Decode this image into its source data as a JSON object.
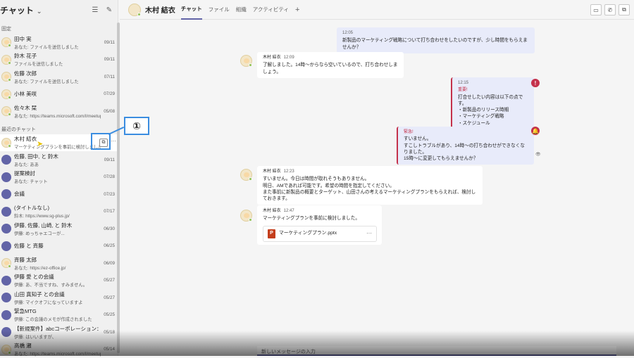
{
  "sidebar": {
    "title": "チャット",
    "pinned_label": "固定",
    "recent_label": "最近のチャット",
    "pinned": [
      {
        "name": "田中 実",
        "preview": "あなた: ファイルを送信しました",
        "date": "09/11"
      },
      {
        "name": "鈴木 花子",
        "preview": "ファイルを送信しました",
        "date": "09/11"
      },
      {
        "name": "佐藤 次郎",
        "preview": "あなた: ファイルを送信しました",
        "date": "07/11"
      },
      {
        "name": "小林 美咲",
        "preview": "",
        "date": "07/29"
      },
      {
        "name": "佐々木 栞",
        "preview": "あなた: https://teams.microsoft.com/l/meetup-joi...",
        "date": "05/08"
      }
    ],
    "recent": [
      {
        "name": "木村 結衣",
        "preview": "マーケティングプランを事前に検討しました。",
        "date": ""
      },
      {
        "name": "佐藤, 田中, と 鈴木",
        "preview": "あなた: ああ",
        "date": "09/11"
      },
      {
        "name": "提案検討",
        "preview": "あなた: チャット",
        "date": "07/28"
      },
      {
        "name": "会議",
        "preview": "",
        "date": "07/23"
      },
      {
        "name": "(タイトルなし)",
        "preview": "鈴木: https://www.sg-plus.jp/",
        "date": "07/17"
      },
      {
        "name": "伊藤, 佐藤, 山崎, と 鈴木",
        "preview": "伊藤: めっちゃエコーが...",
        "date": "06/30"
      },
      {
        "name": "佐藤 と 斉藤",
        "preview": "",
        "date": "06/25"
      },
      {
        "name": "斉藤 太郎",
        "preview": "あなた: https://ez-office.jp/",
        "date": "06/09"
      },
      {
        "name": "伊藤 愛 との会議",
        "preview": "伊藤: あ、不当ですね、すみません。",
        "date": "05/27"
      },
      {
        "name": "山田 真知子 との会議",
        "preview": "伊藤: マイクオフになっていますよ",
        "date": "05/27"
      },
      {
        "name": "緊急MTG",
        "preview": "伊藤: この会議のメモが作成されました",
        "date": "05/25"
      },
      {
        "name": "【新規案件】abcコーポレーション：ヒアリン...",
        "preview": "伊藤: はいいますが、",
        "date": "05/18"
      },
      {
        "name": "高橋 瀬",
        "preview": "あなた: https://teams.microsoft.com/l/meetup-joi...",
        "date": "05/14"
      }
    ]
  },
  "header": {
    "contact_name": "木村 結衣",
    "tabs": [
      "チャット",
      "ファイル",
      "組織",
      "アクティビティ"
    ]
  },
  "callout": {
    "label": "①"
  },
  "messages": {
    "m1": {
      "time": "12:05",
      "text": "新製品のマーケティング戦略について打ち合わせをしたいのですが、少し時間をもらえませんか？"
    },
    "m2": {
      "sender": "木村 結衣",
      "time": "12:09",
      "text": "了解しました。14時〜からなら空いているので、打ち合わせしましょう。"
    },
    "m3": {
      "time": "12:15",
      "flag": "重要!",
      "lines": [
        "打合せしたい内容は以下の点です。",
        "・新製品のリリース時期",
        "・マーケティング戦略",
        "・スケジュール"
      ]
    },
    "m4": {
      "flag": "緊急!",
      "lines": [
        "すいません。",
        "すこしトラブルがあり、14時〜の打ち合わせができなくなりました。",
        "15時〜に変更してもらえませんか？"
      ]
    },
    "m5": {
      "sender": "木村 結衣",
      "time": "12:23",
      "lines": [
        "すいません。今日は時間が取れそうもありません。",
        "明日、AMであれば可能です。希望の時間を指定してください。",
        "また事前に新製品の概要とターゲット、山田さんの考えるマーケティングプランをもらえれば、検討しておきます。"
      ]
    },
    "m6": {
      "sender": "木村 結衣",
      "time": "12:47",
      "text": "マーケティングプランを事前に検討しました。",
      "file_name": "マーケティングプラン.pptx"
    }
  },
  "composer": {
    "placeholder": "新しいメッセージの入力"
  },
  "colors": {
    "accent": "#6264a7",
    "urgent": "#c4314b",
    "callout": "#3b8de0"
  }
}
